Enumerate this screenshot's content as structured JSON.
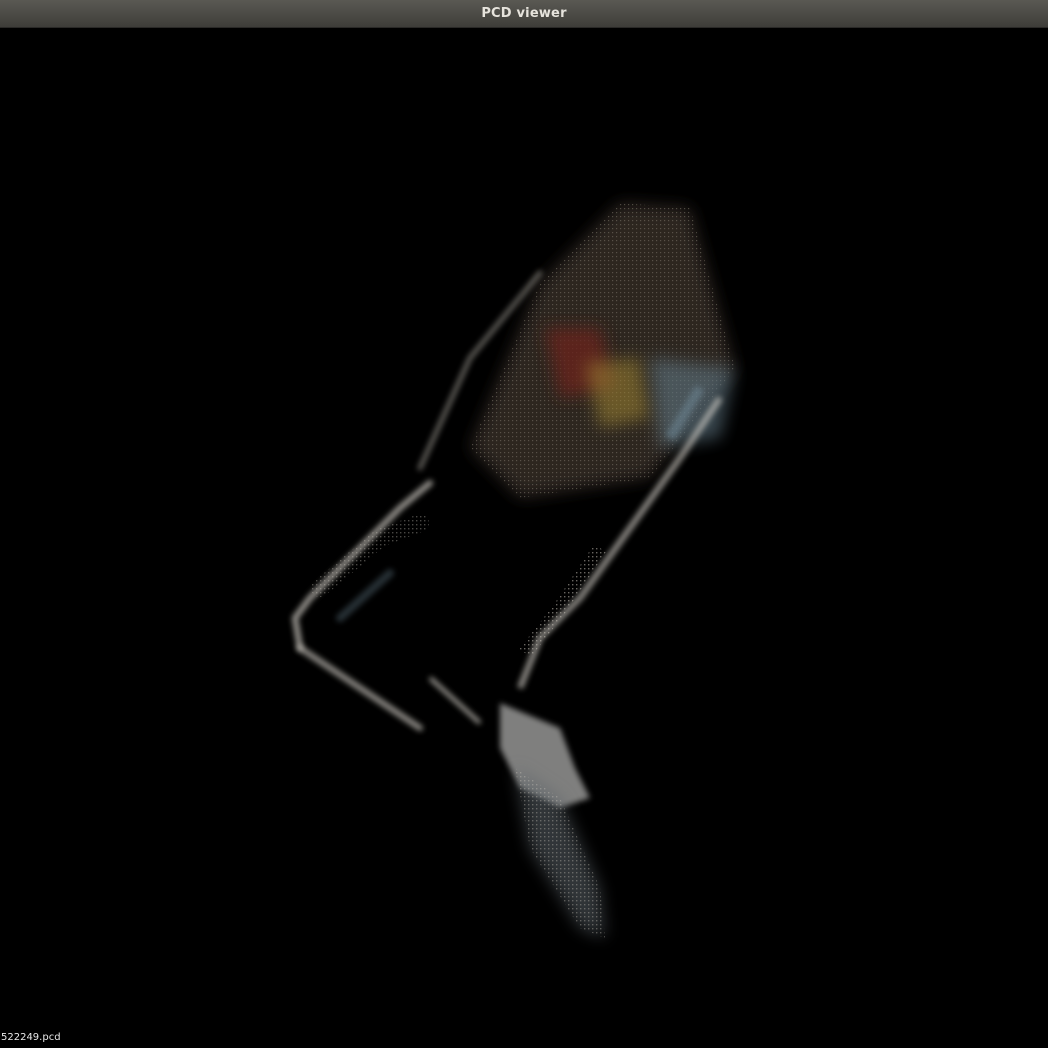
{
  "window": {
    "title": "PCD viewer"
  },
  "viewport": {
    "filename_label": "522249.pcd",
    "background_color": "#000000",
    "point_cloud_tint": [
      "#d8d4cc",
      "#8a7a66",
      "#7a2a24",
      "#b89a3a",
      "#6f8a99",
      "#ffffff"
    ]
  }
}
